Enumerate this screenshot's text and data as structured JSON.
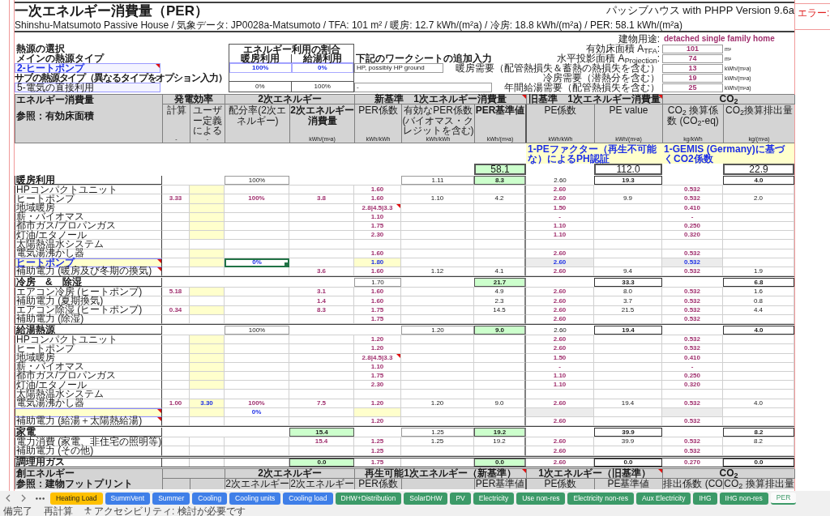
{
  "sheet": {
    "title": "一次エネルギー消費量（PER）",
    "version": "パッシブハウス with PHPP Version 9.6a",
    "subtitle": "Shinshu-Matsumoto Passive House / 気象データ: JP0028a-Matsumoto / TFA: 101 m² / 暖房: 12.7 kWh/(m²a) / 冷房: 18.8 kWh/(m²a) / PER: 58.1 kWh/(m²a)"
  },
  "error_panel": {
    "label": "エラー:"
  },
  "heat_source": {
    "heading": "熱源の選択",
    "main_label": "メインの熱源タイプ",
    "main_value": "2-ヒートポンプ",
    "main_comment": true,
    "sub_label": "サブの熱源タイプ（異なるタイプをオプション入力）",
    "sub_value": "5-電気の直接利用",
    "sub_comment": false
  },
  "energy_share": {
    "title": "エネルギー利用の割合",
    "columns": [
      "暖房利用",
      "給湯利用"
    ],
    "main": [
      "100%",
      "0%"
    ],
    "sub": [
      "0%",
      "100%"
    ]
  },
  "worksheet_input": {
    "heading": "下記のワークシートの追加入力",
    "main_value": "HP, possibly HP ground",
    "sub_value": "-"
  },
  "building": [
    {
      "kind": "text",
      "label": "建物用途:",
      "value": "detached single family home"
    },
    {
      "kind": "number",
      "label": "有効床面積 A$_{TFA}$:",
      "value": "101",
      "unit": "m²"
    },
    {
      "kind": "number",
      "label": "水平投影面積 A$_{Projection}$:",
      "value": "74",
      "unit": "m²"
    },
    {
      "kind": "number",
      "label": "暖房需要（配管熱損失＆蓄熱の熱損失を含む）",
      "value": "13",
      "unit": "kWh/(m²a)"
    },
    {
      "kind": "number",
      "label": "冷房需要（潜熱分を含む）",
      "value": "19",
      "unit": "kWh/(m²a)"
    },
    {
      "kind": "number",
      "label": "年間給湯需要（配管熱損失を含む）",
      "value": "25",
      "unit": "kWh/(m²a)"
    }
  ],
  "table": {
    "title": "エネルギー消費量",
    "reference_label": "参照：有効床面積",
    "groups": [
      {
        "kind": "efficiency",
        "label": "発電効率",
        "comment": false
      },
      {
        "kind": "secondary",
        "label": "2次エネルギー",
        "comment": false
      },
      {
        "kind": "per",
        "label": "新基準　1次エネルギー消費量",
        "comment": true
      },
      {
        "kind": "pe",
        "label": "旧基準　1次エネルギー消費量",
        "comment": true
      },
      {
        "kind": "co2",
        "label": "CO$_{2}$",
        "comment": false
      }
    ],
    "columns": [
      {
        "label": "計算",
        "unit": "-",
        "bold": false
      },
      {
        "label": "ユーザー定義による",
        "unit": "-",
        "bold": false
      },
      {
        "label": "配分率(2次エネルギー)",
        "bold": false
      },
      {
        "label": "2次エネルギー消費量",
        "unit": "kWh/(m²a)",
        "bold": true
      },
      {
        "label": "PER係数",
        "unit": "kWh/kWh",
        "bold": false
      },
      {
        "label": "有効なPER係数(バイオマス・クレジットを含む)",
        "unit": "kWh/kWh",
        "bold": false
      },
      {
        "label": "PER基準値",
        "unit": "kWh/(m²a)",
        "bold": true
      },
      {
        "label": "PE係数",
        "unit": "kWh/kWh",
        "bold": false
      },
      {
        "label": "PE value",
        "unit": "kWh/(m²a)",
        "bold": false
      },
      {
        "label": "CO$_{2}$ 換算係数 (CO$_{2}$-eq)",
        "unit": "kg/kWh",
        "bold": false
      },
      {
        "label": "CO$_{2}$換算排出量",
        "unit": "kg/(m²a)",
        "bold": false
      }
    ],
    "factor_sources": [
      {
        "text": "1-PEファクター（再生不可能な）によるPH認証"
      },
      {
        "text": "1-GEMIS (Germany)に基づくCO2係数"
      }
    ],
    "totals": {
      "per_value": "58.1",
      "pe_value": "112.0",
      "co2_value": "22.9"
    },
    "sections": [
      {
        "kind": "group",
        "label": "暖房利用",
        "summary": {
          "share": "100%",
          "per_effective": "1.11",
          "per_value": "8.3",
          "pe_factor": "2.60",
          "pe_value": "19.3",
          "co2_value": "4.0"
        },
        "rows": [
          {
            "kind": "item",
            "label": "HPコンパクトユニット",
            "user_input": true,
            "label_comment": false,
            "factor_comment": false,
            "cells": {
              "per_factor": "1.60",
              "pe_factor": "2.60",
              "co2_factor": "0.532"
            }
          },
          {
            "kind": "item",
            "label": "ヒートポンプ",
            "user_input": true,
            "label_comment": false,
            "factor_comment": false,
            "cells": {
              "efficiency_calc": "3.33",
              "share": "100%",
              "secondary": "3.8",
              "per_factor": "1.60",
              "per_effective": "1.10",
              "per_value": "4.2",
              "pe_factor": "2.60",
              "pe_value": "9.9",
              "co2_factor": "0.532",
              "co2_value": "2.0"
            }
          },
          {
            "kind": "item",
            "label": "地域暖房",
            "user_input": true,
            "label_comment": false,
            "factor_comment": true,
            "cells": {
              "per_factor": "2.8|4.5|3.3",
              "pe_factor": "1.50",
              "co2_factor": "0.410"
            }
          },
          {
            "kind": "item",
            "label": "薪・バイオマス",
            "user_input": true,
            "label_comment": false,
            "factor_comment": false,
            "cells": {
              "per_factor": "1.10",
              "pe_factor": "-",
              "co2_factor": "-"
            }
          },
          {
            "kind": "item",
            "label": "都市ガス/プロパンガス",
            "user_input": true,
            "label_comment": false,
            "factor_comment": false,
            "cells": {
              "per_factor": "1.75",
              "pe_factor": "1.10",
              "co2_factor": "0.250"
            }
          },
          {
            "kind": "item",
            "label": "灯油/エタノール",
            "user_input": true,
            "label_comment": false,
            "factor_comment": false,
            "cells": {
              "per_factor": "2.30",
              "pe_factor": "1.10",
              "co2_factor": "0.320"
            }
          },
          {
            "kind": "item",
            "label": "太陽熱温水システム",
            "user_input": false,
            "label_comment": false,
            "factor_comment": false
          },
          {
            "kind": "item",
            "label": "電気湯沸かし器",
            "user_input": true,
            "label_comment": false,
            "factor_comment": false,
            "cells": {
              "per_factor": "1.60",
              "pe_factor": "2.60",
              "co2_factor": "0.532"
            }
          },
          {
            "kind": "input",
            "label": "ヒートポンプ",
            "user_input": true,
            "label_comment": true,
            "factor_comment": false,
            "share_selected": true,
            "cells": {
              "share": "0%",
              "per_factor": "1.80",
              "pe_factor": "2.60",
              "co2_factor": "0.532"
            }
          },
          {
            "kind": "item",
            "label": "補助電力 (暖房及び冬期の換気)",
            "user_input": false,
            "label_comment": true,
            "factor_comment": false,
            "cells": {
              "secondary": "3.6",
              "per_factor": "1.60",
              "per_effective": "1.12",
              "per_value": "4.1",
              "pe_factor": "2.60",
              "pe_value": "9.4",
              "co2_factor": "0.532",
              "co2_value": "1.9"
            }
          }
        ]
      },
      {
        "kind": "group",
        "label": "冷房　&　除湿",
        "summary": {
          "per_factor": "1.70",
          "per_value": "21.7",
          "pe_value": "33.3",
          "co2_value": "6.8"
        },
        "rows": [
          {
            "kind": "item",
            "label": "エアコン冷房 (ヒートポンプ)",
            "user_input": true,
            "label_comment": false,
            "factor_comment": false,
            "cells": {
              "efficiency_calc": "5.18",
              "secondary": "3.1",
              "per_factor": "1.60",
              "per_value": "4.9",
              "pe_factor": "2.60",
              "pe_value": "8.0",
              "co2_factor": "0.532",
              "co2_value": "1.6"
            }
          },
          {
            "kind": "item",
            "label": "補助電力 (夏期換気)",
            "user_input": false,
            "label_comment": false,
            "factor_comment": false,
            "cells": {
              "secondary": "1.4",
              "per_factor": "1.60",
              "per_value": "2.3",
              "pe_factor": "2.60",
              "pe_value": "3.7",
              "co2_factor": "0.532",
              "co2_value": "0.8"
            }
          },
          {
            "kind": "item",
            "label": "エアコン除湿 (ヒートポンプ)",
            "user_input": true,
            "label_comment": false,
            "factor_comment": false,
            "cells": {
              "efficiency_calc": "0.34",
              "secondary": "8.3",
              "per_factor": "1.75",
              "per_value": "14.5",
              "pe_factor": "2.60",
              "pe_value": "21.5",
              "co2_factor": "0.532",
              "co2_value": "4.4"
            }
          },
          {
            "kind": "item",
            "label": "補助電力 (除湿)",
            "user_input": false,
            "label_comment": false,
            "factor_comment": false,
            "cells": {
              "per_factor": "1.75",
              "pe_factor": "2.60",
              "co2_factor": "0.532"
            }
          }
        ]
      },
      {
        "kind": "group",
        "label": "給湯熱源",
        "summary": {
          "share": "100%",
          "per_effective": "1.20",
          "per_value": "9.0",
          "pe_factor": "2.60",
          "pe_value": "19.4",
          "co2_value": "4.0"
        },
        "rows": [
          {
            "kind": "item",
            "label": "HPコンパクトユニット",
            "user_input": true,
            "label_comment": false,
            "factor_comment": false,
            "cells": {
              "per_factor": "1.20",
              "pe_factor": "2.60",
              "co2_factor": "0.532"
            }
          },
          {
            "kind": "item",
            "label": "ヒートポンプ",
            "user_input": true,
            "label_comment": false,
            "factor_comment": false,
            "cells": {
              "per_factor": "1.20",
              "pe_factor": "2.60",
              "co2_factor": "0.532"
            }
          },
          {
            "kind": "item",
            "label": "地域暖房",
            "user_input": true,
            "label_comment": false,
            "factor_comment": true,
            "cells": {
              "per_factor": "2.8|4.5|3.3",
              "pe_factor": "1.50",
              "co2_factor": "0.410"
            }
          },
          {
            "kind": "item",
            "label": "薪・バイオマス",
            "user_input": true,
            "label_comment": false,
            "factor_comment": false,
            "cells": {
              "per_factor": "1.10",
              "pe_factor": "-",
              "co2_factor": "-"
            }
          },
          {
            "kind": "item",
            "label": "都市ガス/プロパンガス",
            "user_input": true,
            "label_comment": false,
            "factor_comment": false,
            "cells": {
              "per_factor": "1.75",
              "pe_factor": "1.10",
              "co2_factor": "0.250"
            }
          },
          {
            "kind": "item",
            "label": "灯油/エタノール",
            "user_input": true,
            "label_comment": false,
            "factor_comment": false,
            "cells": {
              "per_factor": "2.30",
              "pe_factor": "1.10",
              "co2_factor": "0.320"
            }
          },
          {
            "kind": "item",
            "label": "太陽熱温水システム",
            "user_input": false,
            "label_comment": false,
            "factor_comment": false
          },
          {
            "kind": "item",
            "label": "電気湯沸かし器",
            "user_input": true,
            "label_comment": false,
            "factor_comment": false,
            "cells": {
              "efficiency_calc": "1.00",
              "efficiency_user": "3.30",
              "share": "100%",
              "secondary": "7.5",
              "per_factor": "1.20",
              "per_effective": "1.20",
              "per_value": "9.0",
              "pe_factor": "2.60",
              "pe_value": "19.4",
              "co2_factor": "0.532",
              "co2_value": "4.0"
            }
          },
          {
            "kind": "input",
            "user_input": true,
            "label_comment": true,
            "factor_comment": false,
            "share_selected": false,
            "cells": {
              "share": "0%"
            }
          },
          {
            "kind": "item",
            "label": "補助電力 (給湯＋太陽熱給湯)",
            "user_input": false,
            "label_comment": true,
            "factor_comment": false,
            "cells": {
              "per_factor": "1.20",
              "pe_factor": "2.60",
              "co2_factor": "0.532"
            }
          }
        ]
      },
      {
        "kind": "group",
        "label": "家電",
        "summary": {
          "secondary": "15.4",
          "per_effective": "1.25",
          "per_value": "19.2",
          "pe_value": "39.9",
          "co2_value": "8.2"
        },
        "rows": [
          {
            "kind": "item",
            "label": "電力消費 (家電、非住宅の照明等)",
            "user_input": false,
            "label_comment": false,
            "factor_comment": false,
            "cells": {
              "secondary": "15.4",
              "per_factor": "1.25",
              "per_effective": "1.25",
              "per_value": "19.2",
              "pe_factor": "2.60",
              "pe_value": "39.9",
              "co2_factor": "0.532",
              "co2_value": "8.2"
            }
          },
          {
            "kind": "item",
            "label": "補助電力 (その他)",
            "user_input": false,
            "label_comment": false,
            "factor_comment": false,
            "cells": {
              "per_factor": "1.25",
              "pe_factor": "2.60",
              "co2_factor": "0.532"
            }
          }
        ]
      },
      {
        "kind": "single",
        "label": "調理用ガス",
        "summary": {
          "secondary": "0.0",
          "per_factor": "1.75",
          "per_value": "0.0",
          "pe_factor": "2.60",
          "pe_value": "0.0",
          "co2_factor": "0.270",
          "co2_value": "0.0"
        }
      }
    ]
  },
  "production": {
    "title": "創エネルギー",
    "reference_label": "参照：建物フットプリント",
    "groups": [
      {
        "kind": "secondary",
        "label": "2次エネルギー",
        "comment": false
      },
      {
        "kind": "per",
        "label": "再生可能1次エネルギー（新基準）",
        "comment": true
      },
      {
        "kind": "pe",
        "label": "1次エネルギー（旧基準）",
        "comment": true
      },
      {
        "kind": "co2",
        "label": "CO$_{2}$",
        "comment": false
      }
    ],
    "columns": {
      "share": "2次エネルギー",
      "secondary": "2次エネルギー",
      "per_factor": "PER係数",
      "per_value": "PER基準値",
      "pe_factor": "PE係数",
      "pe_value": "PE基準値",
      "co2_factor": "排出係数 (CO",
      "co2_value": "CO$_{2}$ 換算排出量"
    }
  },
  "tabs": [
    {
      "label": "Heating Load",
      "color": "#ffc000",
      "selected": false
    },
    {
      "label": "SummVent",
      "color": "#3f7fe8",
      "selected": false
    },
    {
      "label": "Summer",
      "color": "#3f7fe8",
      "selected": false
    },
    {
      "label": "Cooling",
      "color": "#3f7fe8",
      "selected": false
    },
    {
      "label": "Cooling units",
      "color": "#3f7fe8",
      "selected": false
    },
    {
      "label": "Cooling load",
      "color": "#3f7fe8",
      "selected": false
    },
    {
      "label": "DHW+Distribution",
      "color": "#3c9a68",
      "selected": false
    },
    {
      "label": "SolarDHW",
      "color": "#3c9a68",
      "selected": false
    },
    {
      "label": "PV",
      "color": "#3c9a68",
      "selected": false
    },
    {
      "label": "Electricity",
      "color": "#3c9a68",
      "selected": false
    },
    {
      "label": "Use non-res",
      "color": "#3c9a68",
      "selected": false
    },
    {
      "label": "Electricity non-res",
      "color": "#3c9a68",
      "selected": false
    },
    {
      "label": "Aux Electricity",
      "color": "#3c9a68",
      "selected": false
    },
    {
      "label": "IHG",
      "color": "#3c9a68",
      "selected": false
    },
    {
      "label": "IHG non-res",
      "color": "#3c9a68",
      "selected": false
    },
    {
      "label": "PER",
      "color": "#3c9a68",
      "selected": true
    }
  ],
  "status_bar": [
    {
      "kind": "text",
      "label": "備完了"
    },
    {
      "kind": "text",
      "label": "再計算"
    },
    {
      "kind": "accessibility",
      "label": "アクセシビリティ: 検討が必要です"
    }
  ]
}
